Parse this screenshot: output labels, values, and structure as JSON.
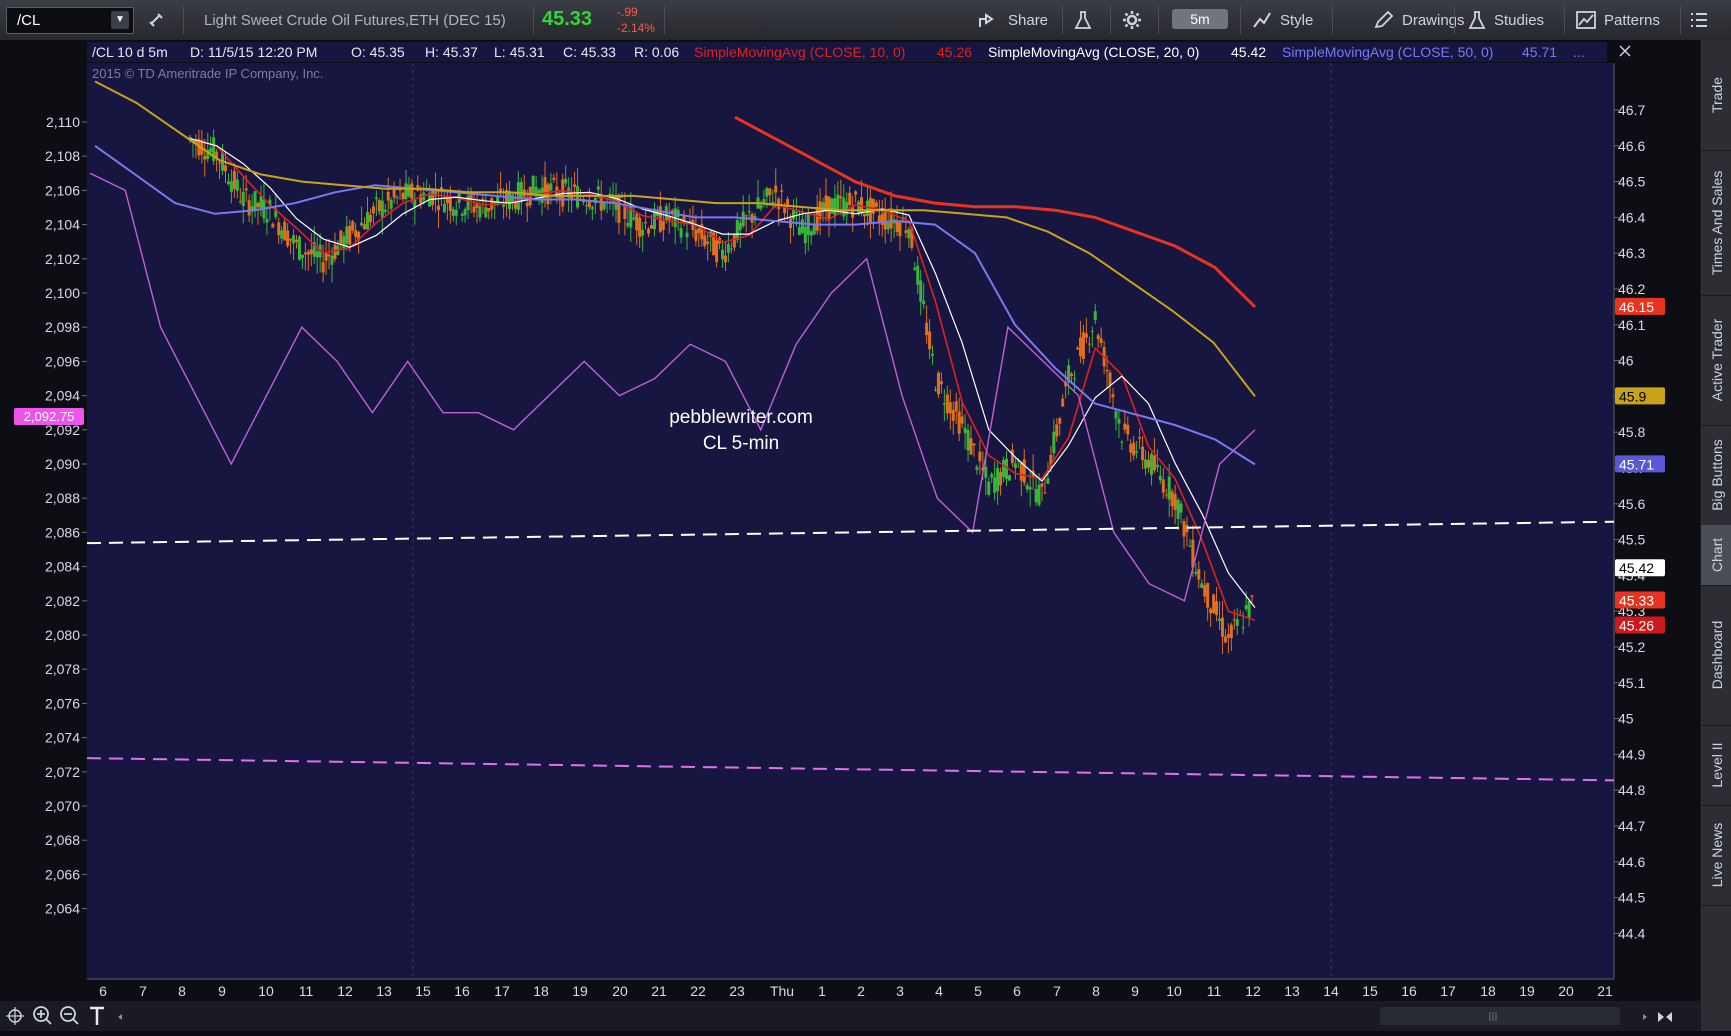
{
  "toolbar": {
    "symbol": "/CL",
    "description": "Light Sweet Crude Oil Futures,ETH (DEC 15)",
    "last_price": "45.33",
    "net_change": "-.99",
    "pct_change": "-2.14%",
    "share_label": "Share",
    "timeframe": "5m",
    "style_label": "Style",
    "drawings_label": "Drawings",
    "studies_label": "Studies",
    "patterns_label": "Patterns"
  },
  "chart_header": {
    "period": "/CL 10 d 5m",
    "date": "D: 11/5/15 12:20 PM",
    "open": "O: 45.35",
    "high": "H: 45.37",
    "low": "L: 45.31",
    "close": "C: 45.33",
    "range": "R: 0.06",
    "sma10_label": "SimpleMovingAvg (CLOSE, 10, 0)",
    "sma10_value": "45.26",
    "sma20_label": "SimpleMovingAvg (CLOSE, 20, 0)",
    "sma20_value": "45.42",
    "sma50_label": "SimpleMovingAvg (CLOSE, 50, 0)",
    "sma50_value": "45.71",
    "more": "..."
  },
  "copyright": "2015 © TD Ameritrade IP Company, Inc.",
  "watermark": {
    "line1": "pebblewriter.com",
    "line2": "CL 5-min"
  },
  "sidebar_tabs": [
    "Trade",
    "Times And Sales",
    "Active Trader",
    "Big Buttons",
    "Chart",
    "Dashboard",
    "Level II",
    "Live News"
  ],
  "colors": {
    "plot_bg": "#161640",
    "sma10": "#e02020",
    "sma20": "#ffffff",
    "sma50": "#7b78ee",
    "sma100": "#c9a21a",
    "sma200": "#e8341e",
    "es_overlay": "#c060d8",
    "up_candle": "#3ab53a",
    "down_candle": "#e0701a"
  },
  "chart_data": {
    "type": "line",
    "left_axis": {
      "label_values": [
        "2,110",
        "2,108",
        "2,106",
        "2,104",
        "2,102",
        "2,100",
        "2,098",
        "2,096",
        "2,094",
        "2,092",
        "2,090",
        "2,088",
        "2,086",
        "2,084",
        "2,082",
        "2,080",
        "2,078",
        "2,076",
        "2,074",
        "2,072",
        "2,070",
        "2,068",
        "2,066",
        "2,064"
      ],
      "ylim": [
        2063,
        2111
      ],
      "current": "2,092.75"
    },
    "right_axis": {
      "label_values": [
        "46.7",
        "46.6",
        "46.5",
        "46.4",
        "46.3",
        "46.2",
        "46.1",
        "46",
        "45.9",
        "45.8",
        "45.7",
        "45.6",
        "45.5",
        "45.4",
        "45.3",
        "45.2",
        "45.1",
        "45",
        "44.9",
        "44.8",
        "44.7",
        "44.6",
        "44.5",
        "44.4"
      ],
      "ylim": [
        44.4,
        46.7
      ],
      "badges": [
        {
          "value": "46.15",
          "color": "#e8341e",
          "text_color": "#ffffff"
        },
        {
          "value": "45.9",
          "color": "#c9a21a",
          "text_color": "#000000"
        },
        {
          "value": "45.71",
          "color": "#5b58d8",
          "text_color": "#ffffff"
        },
        {
          "value": "45.42",
          "color": "#ffffff",
          "text_color": "#000000"
        },
        {
          "value": "45.33",
          "color": "#e8341e",
          "text_color": "#ffffff"
        },
        {
          "value": "45.26",
          "color": "#cc1a1a",
          "text_color": "#ffffff"
        }
      ]
    },
    "x_labels": [
      "6",
      "7",
      "8",
      "9",
      "10",
      "11",
      "12",
      "13",
      "15",
      "16",
      "17",
      "18",
      "19",
      "20",
      "21",
      "22",
      "23",
      "Thu",
      "1",
      "2",
      "3",
      "4",
      "5",
      "6",
      "7",
      "8",
      "9",
      "10",
      "11",
      "12",
      "13",
      "14",
      "15",
      "16",
      "17",
      "18",
      "19",
      "20",
      "21"
    ],
    "oil_closes": [
      46.62,
      46.58,
      46.45,
      46.42,
      46.32,
      46.28,
      46.35,
      46.42,
      46.46,
      46.47,
      46.44,
      46.43,
      46.45,
      46.48,
      46.47,
      46.46,
      46.43,
      46.38,
      46.4,
      46.36,
      46.3,
      46.4,
      46.47,
      46.36,
      46.43,
      46.44,
      46.4,
      46.38,
      45.95,
      45.82,
      45.65,
      45.72,
      45.62,
      45.95,
      46.12,
      45.8,
      45.72,
      45.62,
      45.38,
      45.22,
      45.33
    ],
    "sma200": [
      null,
      null,
      null,
      null,
      null,
      null,
      null,
      null,
      null,
      null,
      null,
      null,
      null,
      null,
      null,
      null,
      46.68,
      46.62,
      46.56,
      46.5,
      46.46,
      46.44,
      46.43,
      46.43,
      46.42,
      46.4,
      46.36,
      46.32,
      46.26,
      46.15
    ],
    "sma100": [
      46.78,
      46.72,
      46.64,
      46.56,
      46.52,
      46.5,
      46.49,
      46.48,
      46.48,
      46.47,
      46.47,
      46.46,
      46.46,
      46.46,
      46.45,
      46.44,
      46.44,
      46.43,
      46.42,
      46.42,
      46.42,
      46.41,
      46.4,
      46.36,
      46.3,
      46.22,
      46.14,
      46.05,
      45.9
    ],
    "sma50": [
      46.6,
      46.52,
      46.44,
      46.41,
      46.42,
      46.44,
      46.47,
      46.49,
      46.48,
      46.47,
      46.46,
      46.45,
      46.45,
      46.44,
      46.42,
      46.4,
      46.4,
      46.39,
      46.38,
      46.38,
      46.39,
      46.38,
      46.3,
      46.1,
      45.98,
      45.88,
      45.85,
      45.82,
      45.78,
      45.71
    ],
    "es_overlay": [
      2107,
      2106,
      2098,
      2094,
      2090,
      2094,
      2098,
      2096,
      2093,
      2096,
      2093,
      2093,
      2092,
      2094,
      2096,
      2094,
      2095,
      2097,
      2096,
      2092,
      2097,
      2100,
      2102,
      2094,
      2088,
      2086,
      2098,
      2096,
      2094,
      2086,
      2083,
      2082,
      2090,
      2092
    ],
    "reference_lines": [
      {
        "name": "white dashed trendline",
        "color": "#ffffff",
        "start": 45.49,
        "end": 45.55
      },
      {
        "name": "magenta dashed trendline",
        "color": "#e070f0",
        "start": 2072.8,
        "end": 2071.5
      }
    ]
  }
}
